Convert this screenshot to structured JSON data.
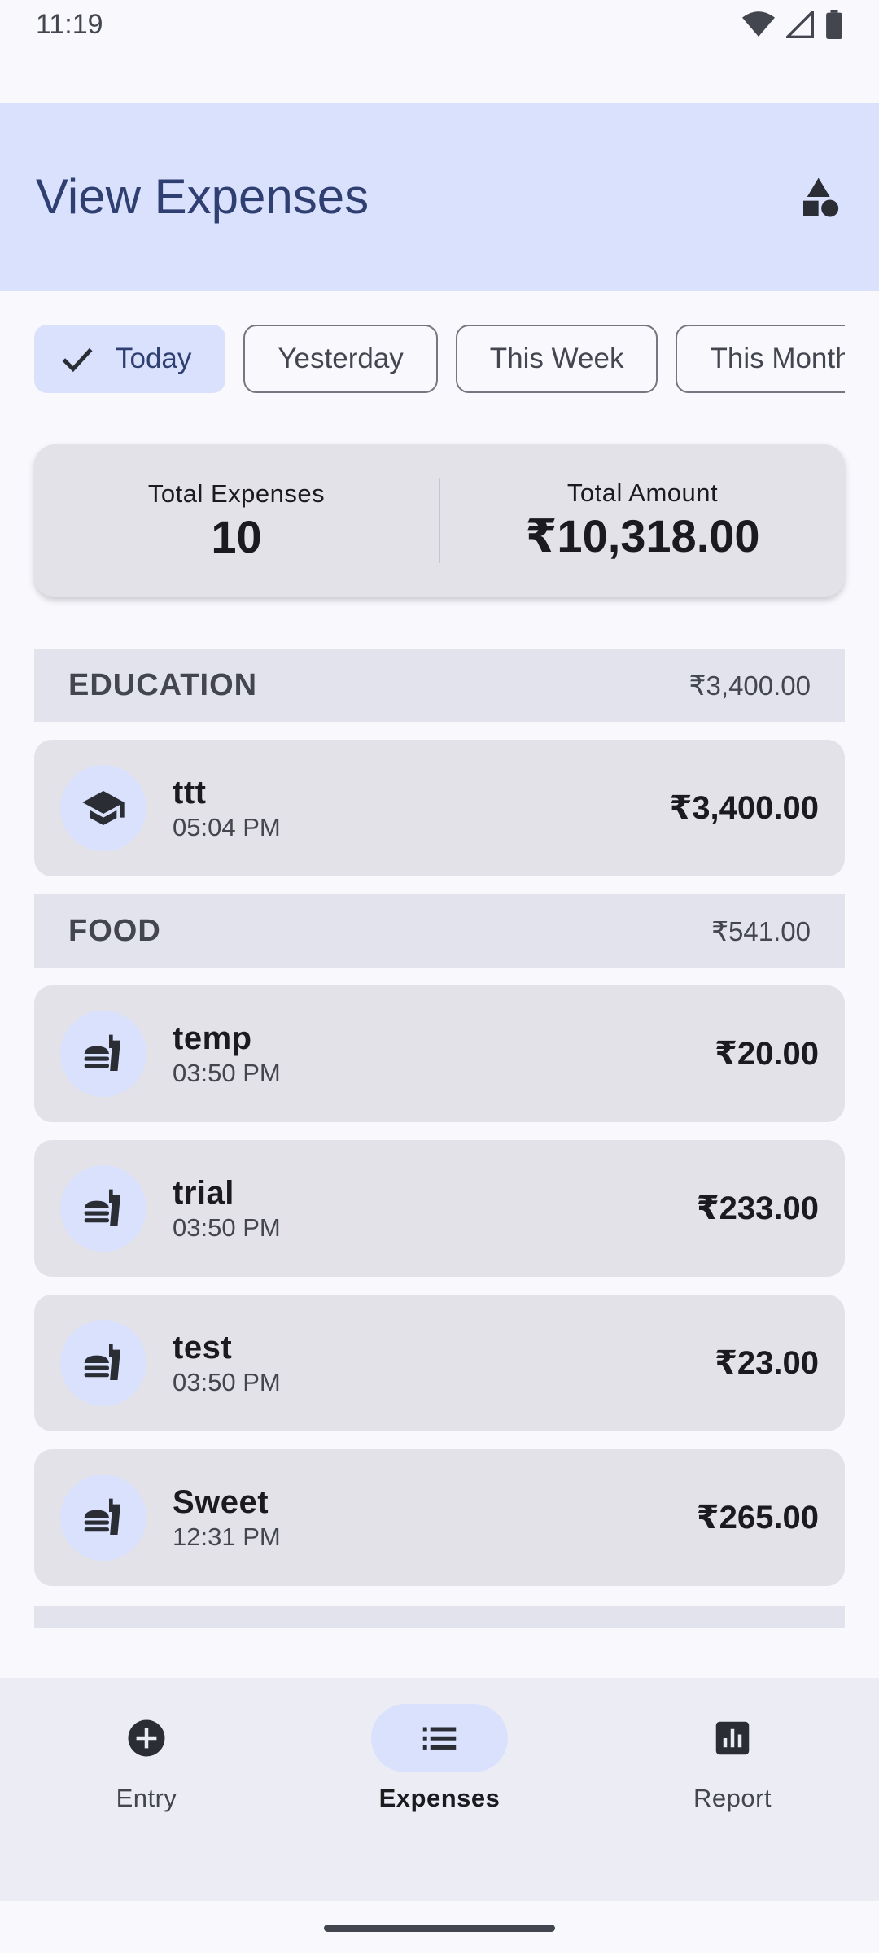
{
  "status_bar": {
    "time": "11:19"
  },
  "app_bar": {
    "title": "View Expenses",
    "action_icon": "shapes-icon"
  },
  "filters": {
    "chips": [
      {
        "label": "Today",
        "selected": true
      },
      {
        "label": "Yesterday",
        "selected": false
      },
      {
        "label": "This Week",
        "selected": false
      },
      {
        "label": "This Month",
        "selected": false
      }
    ]
  },
  "summary": {
    "count_label": "Total Expenses",
    "count_value": "10",
    "amount_label": "Total Amount",
    "amount_value": "₹10,318.00"
  },
  "categories": [
    {
      "name": "EDUCATION",
      "total": "₹3,400.00",
      "icon": "school-icon",
      "items": [
        {
          "name": "ttt",
          "time": "05:04 PM",
          "amount": "₹3,400.00"
        }
      ]
    },
    {
      "name": "FOOD",
      "total": "₹541.00",
      "icon": "fastfood-icon",
      "items": [
        {
          "name": "temp",
          "time": "03:50 PM",
          "amount": "₹20.00"
        },
        {
          "name": "trial",
          "time": "03:50 PM",
          "amount": "₹233.00"
        },
        {
          "name": "test",
          "time": "03:50 PM",
          "amount": "₹23.00"
        },
        {
          "name": "Sweet",
          "time": "12:31 PM",
          "amount": "₹265.00"
        }
      ]
    }
  ],
  "bottom_nav": {
    "items": [
      {
        "label": "Entry",
        "icon": "add-circle-icon",
        "active": false
      },
      {
        "label": "Expenses",
        "icon": "list-icon",
        "active": true
      },
      {
        "label": "Report",
        "icon": "bar-chart-icon",
        "active": false
      }
    ]
  },
  "colors": {
    "accent_container": "#dae1fd",
    "title": "#2f3f72",
    "card": "#e3e2e8",
    "background": "#f8f8fd"
  }
}
